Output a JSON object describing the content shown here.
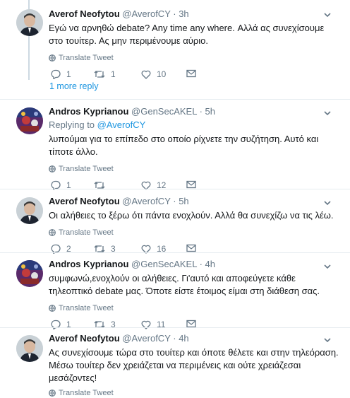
{
  "translate_label": "Translate Tweet",
  "more_replies": "1 more reply",
  "tweets": [
    {
      "name": "Averof Neofytou",
      "handle": "@AverofCY",
      "time": "· 3h",
      "replying_to": "",
      "text": "Εγώ να αρνηθώ debate? Any time any where. Αλλά ας συνεχίσουμε στο τουίτερ. Ας μην περιμένουμε αύριο.",
      "replies": "1",
      "retweets": "1",
      "likes": "10"
    },
    {
      "name": "Andros Kyprianou",
      "handle": "@GenSecAKEL",
      "time": "· 5h",
      "replying_to_prefix": "Replying to",
      "replying_to": "@AverofCY",
      "text": "λυπούμαι για το επίπεδο στο οποίο ρίχνετε την συζήτηση. Αυτό και τίποτε άλλο.",
      "replies": "1",
      "retweets": "",
      "likes": "12"
    },
    {
      "name": "Averof Neofytou",
      "handle": "@AverofCY",
      "time": "· 5h",
      "replying_to": "",
      "text": "Οι αλήθειες το ξέρω ότι πάντα ενοχλούν. Αλλά θα συνεχίζω να τις λέω.",
      "replies": "2",
      "retweets": "3",
      "likes": "16"
    },
    {
      "name": "Andros Kyprianou",
      "handle": "@GenSecAKEL",
      "time": "· 4h",
      "replying_to": "",
      "text": "συμφωνώ,ενοχλούν οι αλήθειες. Γι'αυτό και αποφεύγετε κάθε τηλεοπτικό debate μας. Όποτε είστε έτοιμος είμαι στη διάθεση σας.",
      "replies": "1",
      "retweets": "3",
      "likes": "11"
    },
    {
      "name": "Averof Neofytou",
      "handle": "@AverofCY",
      "time": "· 4h",
      "replying_to": "",
      "text": "Ας συνεχίσουμε τώρα στο τουίτερ και όποτε θέλετε και στην τηλεόραση. Μέσω τουίτερ δεν χρειάζεται να περιμένεις και ούτε χρειάζεσαι μεσάζοντες!",
      "replies": "",
      "retweets": "",
      "likes": ""
    }
  ]
}
